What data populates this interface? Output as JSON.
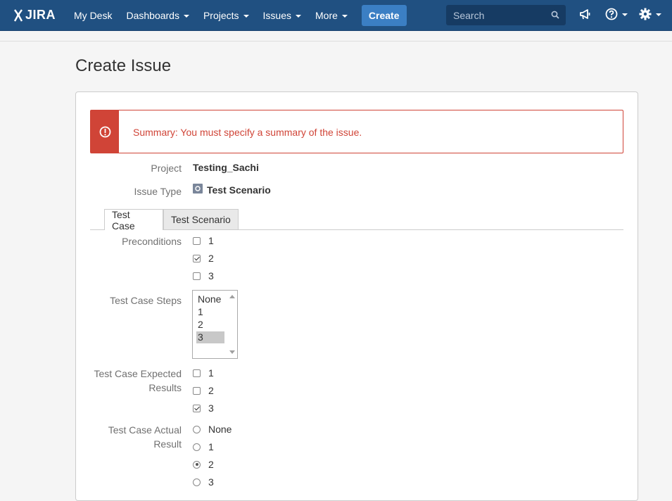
{
  "nav": {
    "logo": "JIRA",
    "items": [
      {
        "label": "My Desk",
        "dropdown": false
      },
      {
        "label": "Dashboards",
        "dropdown": true
      },
      {
        "label": "Projects",
        "dropdown": true
      },
      {
        "label": "Issues",
        "dropdown": true
      },
      {
        "label": "More",
        "dropdown": true
      }
    ],
    "create_label": "Create",
    "search_placeholder": "Search",
    "icons": [
      "search-icon",
      "megaphone-icon",
      "help-icon",
      "gear-icon"
    ]
  },
  "page": {
    "title": "Create Issue"
  },
  "error": {
    "message": "Summary: You must specify a summary of the issue.",
    "color": "#d04437"
  },
  "fields": {
    "project": {
      "label": "Project",
      "value": "Testing_Sachi"
    },
    "issue_type": {
      "label": "Issue Type",
      "value": "Test Scenario"
    }
  },
  "tabs": [
    {
      "label": "Test Case",
      "active": true
    },
    {
      "label": "Test Scenario",
      "active": false
    }
  ],
  "preconditions": {
    "label": "Preconditions",
    "options": [
      {
        "label": "1",
        "checked": false
      },
      {
        "label": "2",
        "checked": true
      },
      {
        "label": "3",
        "checked": false
      }
    ]
  },
  "test_case_steps": {
    "label": "Test Case Steps",
    "options": [
      {
        "label": "None",
        "selected": false
      },
      {
        "label": "1",
        "selected": false
      },
      {
        "label": "2",
        "selected": false
      },
      {
        "label": "3",
        "selected": true
      }
    ]
  },
  "expected_results": {
    "label_line1": "Test Case Expected",
    "label_line2": "Results",
    "options": [
      {
        "label": "1",
        "checked": false
      },
      {
        "label": "2",
        "checked": false
      },
      {
        "label": "3",
        "checked": true
      }
    ]
  },
  "actual_result": {
    "label_line1": "Test Case Actual",
    "label_line2": "Result",
    "options": [
      {
        "label": "None",
        "checked": false
      },
      {
        "label": "1",
        "checked": false
      },
      {
        "label": "2",
        "checked": true
      },
      {
        "label": "3",
        "checked": false
      }
    ]
  },
  "colors": {
    "header": "#205081",
    "create_button": "#3b7fc4",
    "error": "#d04437"
  }
}
